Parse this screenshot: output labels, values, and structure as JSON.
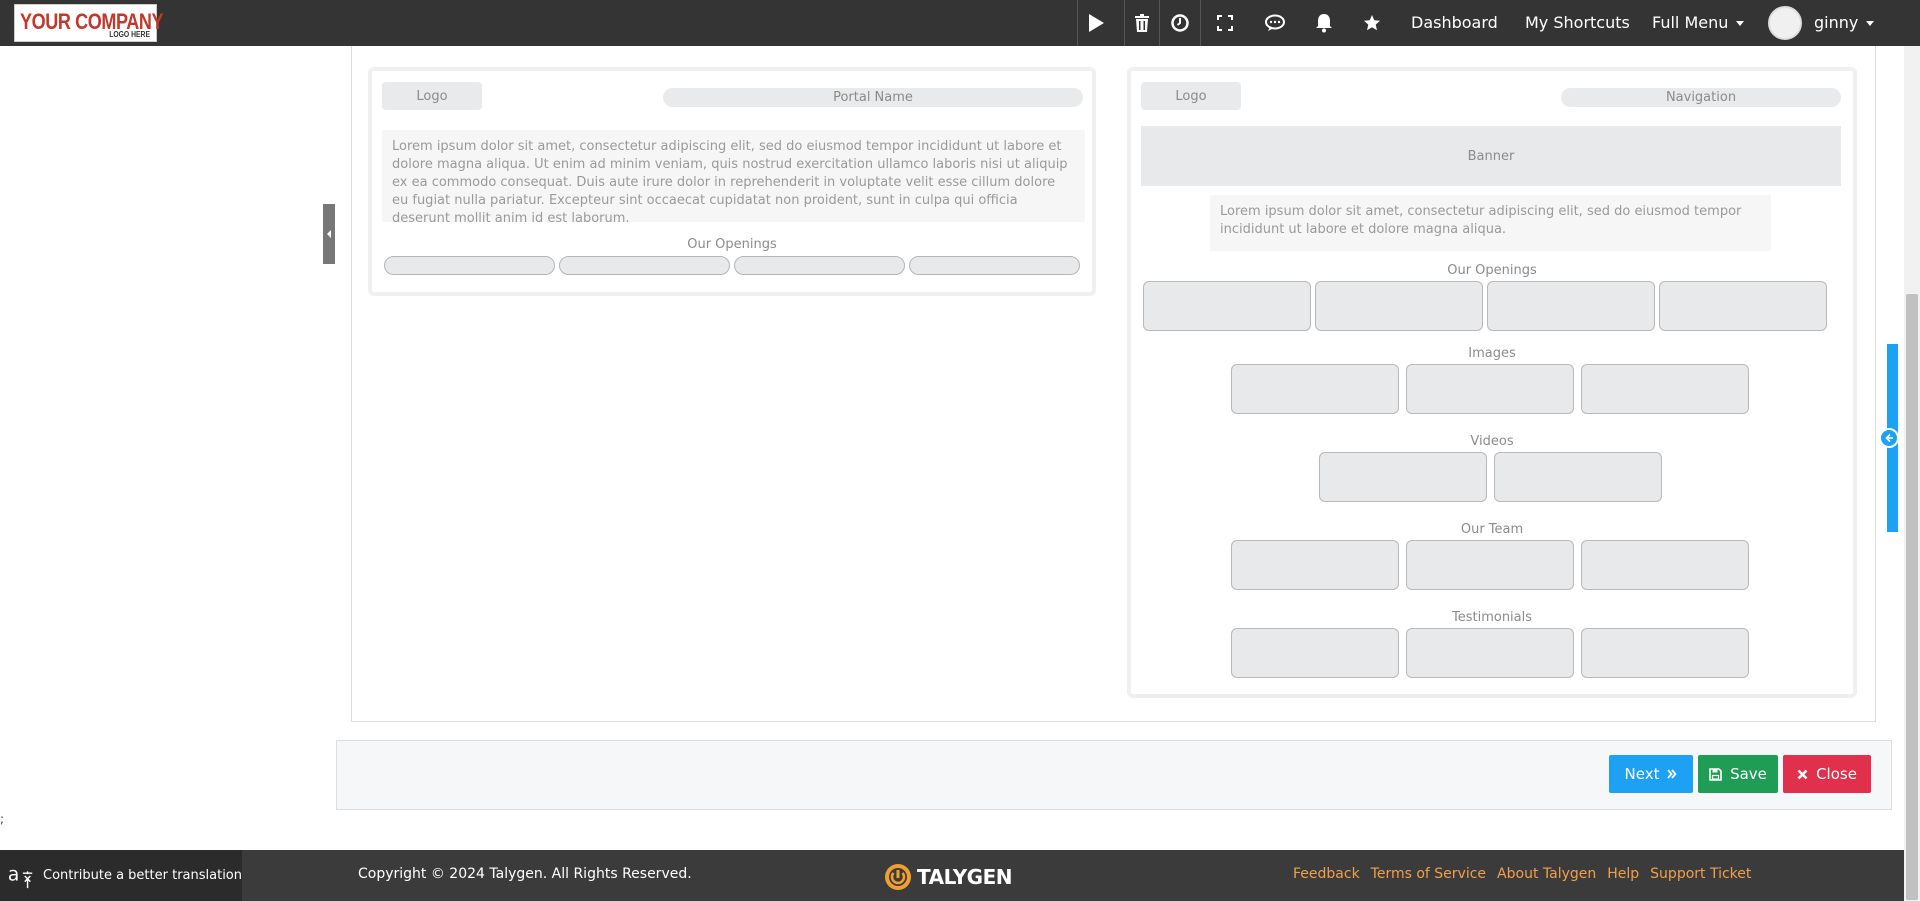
{
  "header": {
    "logo_main": "YOUR COMPANY",
    "logo_sub": "LOGO HERE",
    "nav": {
      "dashboard": "Dashboard",
      "shortcuts": "My Shortcuts",
      "full_menu": "Full Menu",
      "user": "ginny"
    },
    "icons": [
      "play-icon",
      "trash-icon",
      "clock-icon",
      "fullscreen-icon",
      "chat-icon",
      "bell-icon",
      "star-icon"
    ]
  },
  "template_left": {
    "logo": "Logo",
    "portal_name": "Portal Name",
    "lorem": "Lorem ipsum dolor sit amet, consectetur adipiscing elit, sed do eiusmod tempor incididunt ut labore et dolore magna aliqua. Ut enim ad minim veniam, quis nostrud exercitation ullamco laboris nisi ut aliquip ex ea commodo consequat. Duis aute irure dolor in reprehenderit in voluptate velit esse cillum dolore eu fugiat nulla pariatur. Excepteur sint occaecat cupidatat non proident, sunt in culpa qui officia deserunt mollit anim id est laborum.",
    "openings": "Our Openings"
  },
  "template_right": {
    "logo": "Logo",
    "navigation": "Navigation",
    "banner": "Banner",
    "lorem": "Lorem ipsum dolor sit amet, consectetur adipiscing elit, sed do eiusmod tempor incididunt ut labore et dolore magna aliqua.",
    "sections": {
      "openings": "Our Openings",
      "images": "Images",
      "videos": "Videos",
      "team": "Our Team",
      "testimonials": "Testimonials"
    }
  },
  "actions": {
    "next": "Next",
    "save": "Save",
    "close": "Close"
  },
  "footer": {
    "translate": "Contribute a better translation",
    "copyright": "Copyright © 2024 Talygen. All Rights Reserved.",
    "brand": "TALYGEN",
    "links": [
      "Feedback",
      "Terms of Service",
      "About Talygen",
      "Help",
      "Support Ticket"
    ]
  },
  "misc": {
    "stray_char": ";"
  },
  "colors": {
    "topbar": "#343434",
    "next": "#1da1f2",
    "save": "#1f9d55",
    "close": "#e0304b",
    "footer_link": "#f0a04b"
  }
}
